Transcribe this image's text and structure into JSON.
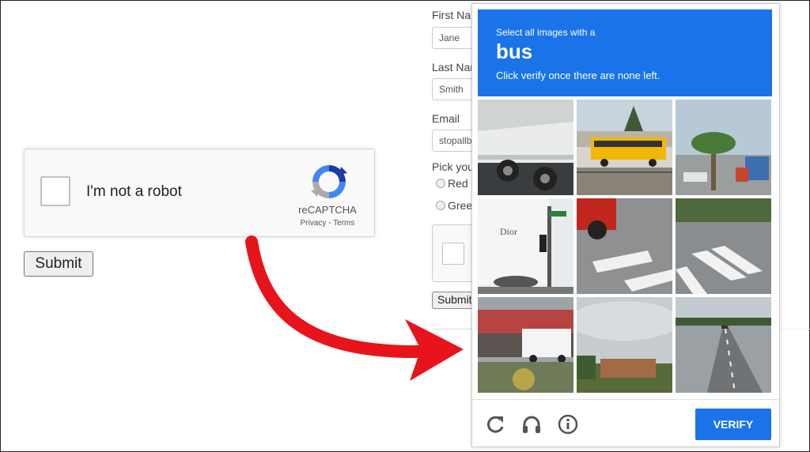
{
  "recaptcha": {
    "checkbox_label": "I'm not a robot",
    "brand": "reCAPTCHA",
    "privacy": "Privacy",
    "separator": " - ",
    "terms": "Terms"
  },
  "form_left": {
    "submit_label": "Submit"
  },
  "background_form": {
    "first_name_label": "First Nar",
    "first_name_value": "Jane",
    "last_name_label": "Last Nar",
    "last_name_value": "Smith",
    "email_label": "Email",
    "email_value": "stopallb",
    "pick_label": "Pick you",
    "radio_red": "Red",
    "radio_green": "Greer",
    "submit_label": "Submit"
  },
  "challenge": {
    "instruction_small": "Select all images with a",
    "target": "bus",
    "instruction_sub": "Click verify once there are none left.",
    "verify_label": "VERIFY",
    "footer_icons": [
      "reload-icon",
      "audio-icon",
      "info-icon"
    ],
    "tiles": [
      "bus-side-closeup",
      "yellow-school-bus",
      "palm-trees-street",
      "building-with-traffic-light",
      "red-truck-crosswalk",
      "crosswalk-intersection",
      "white-bus-storefront",
      "cloudy-sky-buildings",
      "highway-road"
    ]
  },
  "colors": {
    "accent": "#1a73e8",
    "arrow": "#e8141b"
  }
}
